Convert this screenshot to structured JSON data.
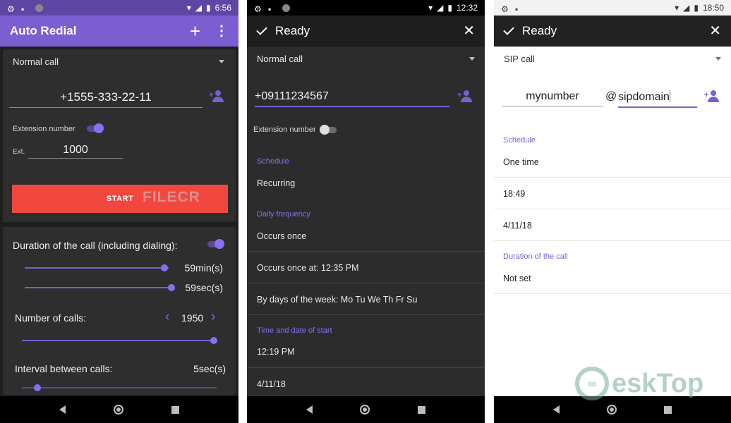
{
  "statusbar": {
    "p1_time": "6:56",
    "p2_time": "12:32",
    "p3_time": "18:50"
  },
  "phone1": {
    "title": "Auto Redial",
    "add_icon": "plus-icon",
    "more_icon": "more-vert-icon",
    "call_type": "Normal call",
    "number": "+1555-333-22-11",
    "extension_label": "Extension number",
    "extension_enabled": true,
    "ext_short": "Ext.",
    "ext_value": "1000",
    "start_label": "START",
    "watermark": "FILECR",
    "duration_label": "Duration of the call (including dialing):",
    "duration_enabled": true,
    "minutes_value": "59min(s)",
    "minutes_fraction": 0.97,
    "seconds_value": "59sec(s)",
    "seconds_fraction": 1.0,
    "calls_label": "Number of calls:",
    "calls_value": "1950",
    "calls_fraction": 1.0,
    "interval_label": "Interval between calls:",
    "interval_value": "5sec(s)",
    "interval_fraction": 0.08
  },
  "phone2": {
    "title": "Ready",
    "call_type": "Normal call",
    "number": "+09111234567",
    "extension_label": "Extension number",
    "extension_enabled": false,
    "schedule_label": "Schedule",
    "schedule_value": "Recurring",
    "daily_label": "Daily frequency",
    "daily_value": "Occurs once",
    "occurs_at": "Occurs once at: 12:35 PM",
    "by_days": "By days of the week: Mo Tu We Th Fr Su",
    "start_label": "Time and date of start",
    "start_time": "12:19 PM",
    "start_date": "4/11/18"
  },
  "phone3": {
    "title": "Ready",
    "call_type": "SIP call",
    "sip_user": "mynumber",
    "at_sign": "@",
    "sip_domain": "sipdomain",
    "schedule_label": "Schedule",
    "schedule_value": "One time",
    "time_value": "18:49",
    "date_value": "4/11/18",
    "duration_label": "Duration of the call",
    "duration_value": "Not set"
  },
  "watermark_brand": "eskTop",
  "colors": {
    "accent": "#7b5ed0",
    "start_button": "#f2473f",
    "dark_bg": "#2c2c2c"
  }
}
